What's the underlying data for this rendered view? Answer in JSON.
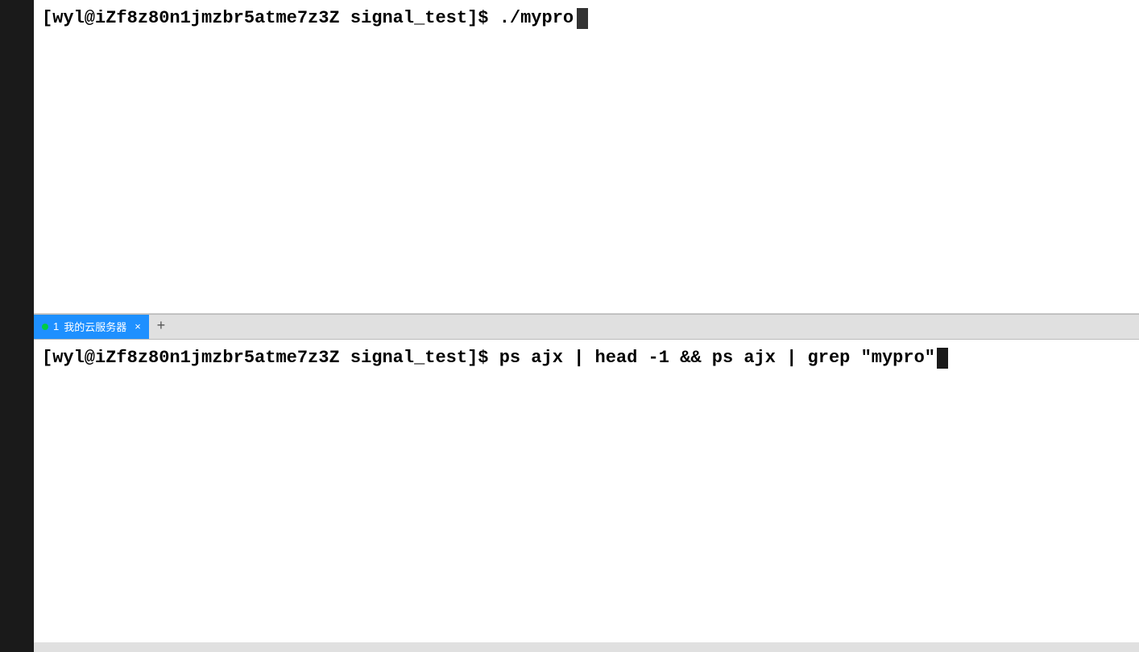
{
  "top_pane": {
    "prompt": "[wyl@iZf8z80n1jmzbr5atme7z3Z signal_test]$ ./mypro"
  },
  "tab_bar": {
    "tab1": {
      "dot_color": "#00cc44",
      "number": "1",
      "label": "我的云服务器",
      "close": "×"
    },
    "add_label": "+"
  },
  "bottom_pane": {
    "prompt": "[wyl@iZf8z80n1jmzbr5atme7z3Z signal_test]$ ps ajx | head -1 && ps ajx | grep \"mypro\""
  }
}
